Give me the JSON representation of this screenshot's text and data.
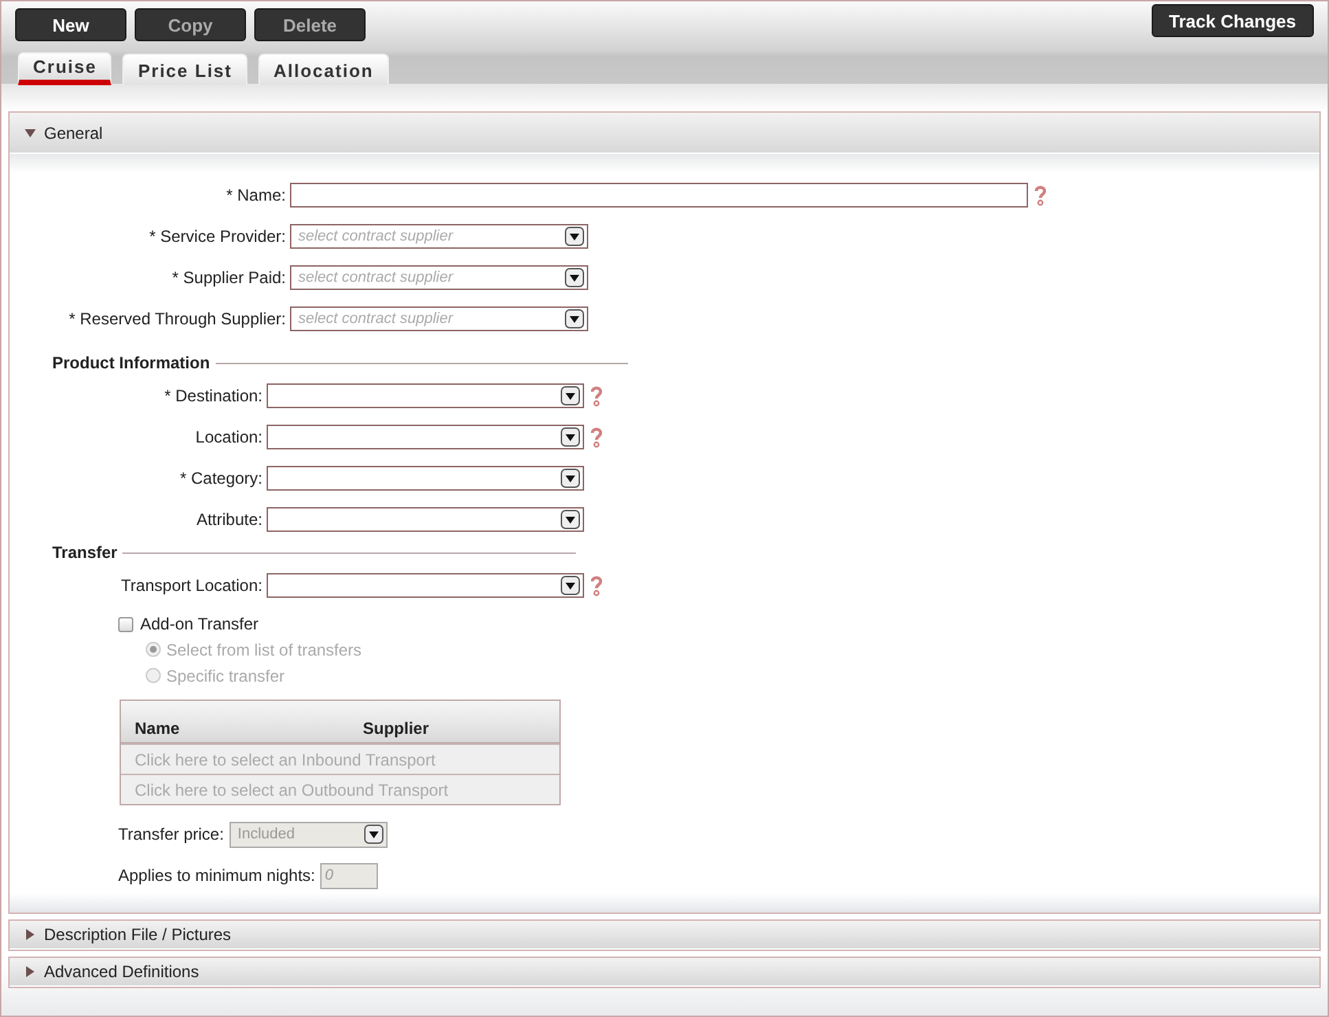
{
  "toolbar": {
    "buttons": [
      {
        "label": "New",
        "disabled": false
      },
      {
        "label": "Copy",
        "disabled": true
      },
      {
        "label": "Delete",
        "disabled": true
      }
    ],
    "track_changes": "Track Changes"
  },
  "tabs": [
    {
      "label": "Cruise",
      "selected": true
    },
    {
      "label": "Price List",
      "selected": false
    },
    {
      "label": "Allocation",
      "selected": false
    }
  ],
  "general": {
    "title": "General",
    "expanded": true,
    "fields": [
      {
        "label": "* Name:",
        "kind": "text",
        "help": true
      },
      {
        "label": "* Service Provider:",
        "kind": "select",
        "placeholder": "select contract supplier",
        "help": false
      },
      {
        "label": "* Supplier Paid:",
        "kind": "select",
        "placeholder": "select contract supplier",
        "help": false
      },
      {
        "label": "* Reserved Through Supplier:",
        "kind": "select",
        "placeholder": "select contract supplier",
        "help": false
      }
    ],
    "product_information": {
      "title": "Product Information",
      "fields": [
        {
          "label": "* Destination:",
          "kind": "select",
          "help": true
        },
        {
          "label": "Location:",
          "kind": "select",
          "help": true
        },
        {
          "label": "* Category:",
          "kind": "select",
          "help": false
        },
        {
          "label": "Attribute:",
          "kind": "select",
          "help": false
        }
      ]
    },
    "transfer": {
      "title": "Transfer",
      "fields": [
        {
          "label": "Transport Location:",
          "kind": "select",
          "help": true
        }
      ],
      "add_on": {
        "label": "Add-on Transfer",
        "checked": false
      },
      "options": [
        {
          "label": "Select from list of transfers",
          "selected": true,
          "disabled": true
        },
        {
          "label": "Specific transfer",
          "selected": false,
          "disabled": true
        }
      ],
      "table": {
        "columns": [
          "Name",
          "Supplier"
        ],
        "rows": [
          "Click here to select an Inbound Transport",
          "Click here to select an Outbound Transport"
        ]
      },
      "price": {
        "label": "Transfer price:",
        "value": "Included",
        "disabled": true
      },
      "min_nights": {
        "label": "Applies to minimum nights:",
        "placeholder": "0",
        "disabled": true
      }
    }
  },
  "sections": [
    {
      "title": "Description File / Pictures",
      "expanded": false
    },
    {
      "title": "Advanced Definitions",
      "expanded": false
    }
  ]
}
